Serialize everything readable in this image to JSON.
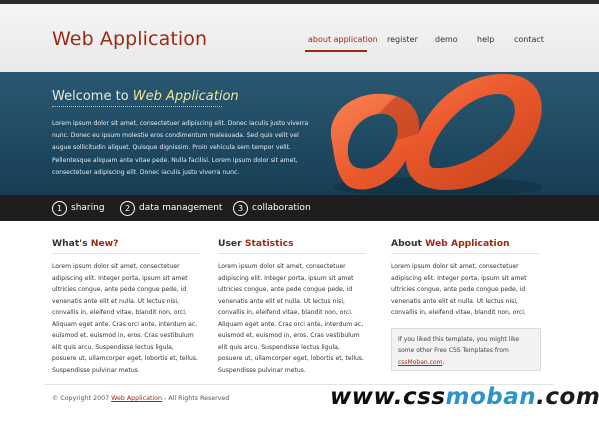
{
  "header": {
    "logo": "Web Application",
    "nav": [
      {
        "label": "about application",
        "active": true
      },
      {
        "label": "register",
        "active": false
      },
      {
        "label": "demo",
        "active": false
      },
      {
        "label": "help",
        "active": false
      },
      {
        "label": "contact",
        "active": false
      }
    ]
  },
  "hero": {
    "title_prefix": "Welcome to ",
    "title_em": "Web Application",
    "text": "Lorem ipsum dolor sit amet, consectetuer adipiscing elit. Donec iaculis justo viverra nunc. Donec eu ipsum molestie eros condimentum malesuada. Sed quis velit vel augue sollicitudin aliquet. Quisque dignissim. Proin vehicula sem tempor velit. Pellentesque aliquam ante vitae pede. Nulla facilisi. Lorem ipsum dolor sit amet, consectetuer adipiscing elit. Donec iaculis justo viverra nunc."
  },
  "features": [
    {
      "num": "1",
      "label": "sharing"
    },
    {
      "num": "2",
      "label": "data management"
    },
    {
      "num": "3",
      "label": "collaboration"
    }
  ],
  "columns": [
    {
      "title_plain": "What's ",
      "title_accent": "New?",
      "text": "Lorem ipsum dolor sit amet, consectetuer adipiscing elit. Integer porta, ipsum sit amet ultricies congue, ante pede congue pede, id venenatis ante elit et nulla. Ut lectus nisi, convallis in, eleifend vitae, blandit non, orci. Aliquam eget ante. Cras orci ante, interdum ac, euismod et, euismod in, eros. Cras vestibulum elit quis arcu. Suspendisse lectus ligula, posuere ut, ullamcorper eget, lobortis et, tellus. Suspendisse pulvinar metus."
    },
    {
      "title_plain": "User ",
      "title_accent": "Statistics",
      "text": "Lorem ipsum dolor sit amet, consectetuer adipiscing elit. Integer porta, ipsum sit amet ultricies congue, ante pede congue pede, id venenatis ante elit et nulla. Ut lectus nisi, convallis in, eleifend vitae, blandit non, orci. Aliquam eget ante. Cras orci ante, interdum ac, euismod et, euismod in, eros. Cras vestibulum elit quis arcu. Suspendisse lectus ligula, posuere ut, ullamcorper eget, lobortis et, tellus. Suspendisse pulvinar metus."
    },
    {
      "title_plain": "About ",
      "title_accent": "Web Application",
      "text": "Lorem ipsum dolor sit amet, consectetuer adipiscing elit. Integer porta, ipsum sit amet ultricies congue, ante pede congue pede, id venenatis ante elit et nulla. Ut lectus nisi, convallis in, eleifend vitae, blandit non, orci."
    }
  ],
  "note": {
    "text": "If you liked this template, you might like some other Free CSS Templates from ",
    "link": "cssMoban.com",
    "end": "."
  },
  "footer": {
    "prefix": "© Copyright 2007 ",
    "link": "Web Application",
    "suffix": " - All Rights Reserved"
  },
  "watermark": {
    "part1": "www.css",
    "part2": "moban",
    "part3": ".com"
  },
  "colors": {
    "accent": "#9b2a12",
    "hero_bg": "#1f4a62",
    "feature_bar": "#1e1e1e",
    "logo_orange": "#ea5a2a"
  },
  "icons": {
    "hero_logo": "infinity-loop-logo"
  }
}
